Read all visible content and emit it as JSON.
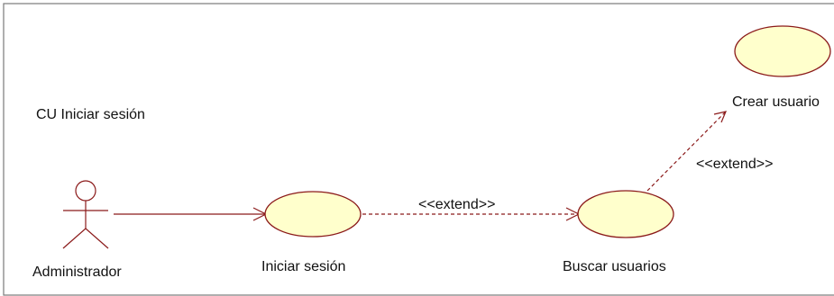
{
  "diagram": {
    "title": "CU Iniciar sesión",
    "actor": {
      "name": "Administrador"
    },
    "use_cases": {
      "login": "Iniciar sesión",
      "search": "Buscar usuarios",
      "create": "Crear usuario"
    },
    "relations": {
      "login_to_search": "<<extend>>",
      "search_to_create": "<<extend>>"
    }
  },
  "colors": {
    "usecase_fill": "#ffffcc",
    "line": "#8b1a1a",
    "frame": "#7a7a7a"
  }
}
